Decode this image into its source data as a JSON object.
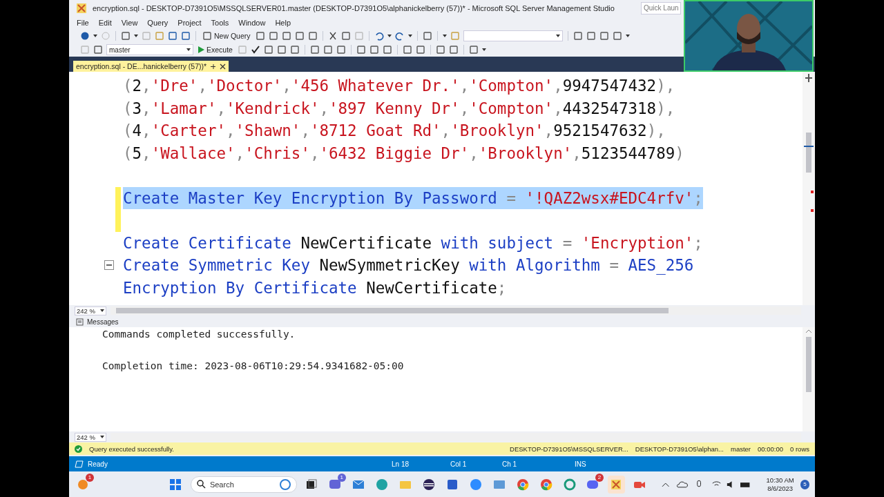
{
  "window": {
    "title": "encryption.sql - DESKTOP-D7391O5\\MSSQLSERVER01.master (DESKTOP-D7391O5\\alphanickelberry (57))* - Microsoft SQL Server Management Studio",
    "quick_launch": {
      "placeholder": "Quick Laun"
    }
  },
  "menu": [
    "File",
    "Edit",
    "View",
    "Query",
    "Project",
    "Tools",
    "Window",
    "Help"
  ],
  "toolbar": {
    "new_query": "New Query",
    "database": "master",
    "execute": "Execute"
  },
  "tabs": [
    {
      "label": "encryption.sql - DE...hanickelberry (57))*",
      "selected": true
    }
  ],
  "editor": {
    "zoom": "242 %",
    "lines": [
      {
        "kind": "code",
        "changed": false,
        "selected": false,
        "collapsible": false,
        "tokens": [
          {
            "kind": "punct",
            "text": "("
          },
          {
            "kind": "plain",
            "text": "2"
          },
          {
            "kind": "punct",
            "text": ","
          },
          {
            "kind": "string",
            "text": "'Dre'"
          },
          {
            "kind": "punct",
            "text": ","
          },
          {
            "kind": "string",
            "text": "'Doctor'"
          },
          {
            "kind": "punct",
            "text": ","
          },
          {
            "kind": "string",
            "text": "'456 Whatever Dr.'"
          },
          {
            "kind": "punct",
            "text": ","
          },
          {
            "kind": "string",
            "text": "'Compton'"
          },
          {
            "kind": "punct",
            "text": ","
          },
          {
            "kind": "plain",
            "text": "9947547432"
          },
          {
            "kind": "punct",
            "text": "),"
          }
        ]
      },
      {
        "kind": "code",
        "changed": false,
        "selected": false,
        "collapsible": false,
        "tokens": [
          {
            "kind": "punct",
            "text": "("
          },
          {
            "kind": "plain",
            "text": "3"
          },
          {
            "kind": "punct",
            "text": ","
          },
          {
            "kind": "string",
            "text": "'Lamar'"
          },
          {
            "kind": "punct",
            "text": ","
          },
          {
            "kind": "string",
            "text": "'Kendrick'"
          },
          {
            "kind": "punct",
            "text": ","
          },
          {
            "kind": "string",
            "text": "'897 Kenny Dr'"
          },
          {
            "kind": "punct",
            "text": ","
          },
          {
            "kind": "string",
            "text": "'Compton'"
          },
          {
            "kind": "punct",
            "text": ","
          },
          {
            "kind": "plain",
            "text": "4432547318"
          },
          {
            "kind": "punct",
            "text": "),"
          }
        ]
      },
      {
        "kind": "code",
        "changed": false,
        "selected": false,
        "collapsible": false,
        "tokens": [
          {
            "kind": "punct",
            "text": "("
          },
          {
            "kind": "plain",
            "text": "4"
          },
          {
            "kind": "punct",
            "text": ","
          },
          {
            "kind": "string",
            "text": "'Carter'"
          },
          {
            "kind": "punct",
            "text": ","
          },
          {
            "kind": "string",
            "text": "'Shawn'"
          },
          {
            "kind": "punct",
            "text": ","
          },
          {
            "kind": "string",
            "text": "'8712 Goat Rd'"
          },
          {
            "kind": "punct",
            "text": ","
          },
          {
            "kind": "string",
            "text": "'Brooklyn'"
          },
          {
            "kind": "punct",
            "text": ","
          },
          {
            "kind": "plain",
            "text": "9521547632"
          },
          {
            "kind": "punct",
            "text": "),"
          }
        ]
      },
      {
        "kind": "code",
        "changed": false,
        "selected": false,
        "collapsible": false,
        "tokens": [
          {
            "kind": "punct",
            "text": "("
          },
          {
            "kind": "plain",
            "text": "5"
          },
          {
            "kind": "punct",
            "text": ","
          },
          {
            "kind": "string",
            "text": "'Wallace'"
          },
          {
            "kind": "punct",
            "text": ","
          },
          {
            "kind": "string",
            "text": "'Chris'"
          },
          {
            "kind": "punct",
            "text": ","
          },
          {
            "kind": "string",
            "text": "'6432 Biggie Dr'"
          },
          {
            "kind": "punct",
            "text": ","
          },
          {
            "kind": "string",
            "text": "'Brooklyn'"
          },
          {
            "kind": "punct",
            "text": ","
          },
          {
            "kind": "plain",
            "text": "5123544789"
          },
          {
            "kind": "punct",
            "text": ")"
          }
        ]
      },
      {
        "kind": "blank",
        "changed": false,
        "selected": false,
        "collapsible": false
      },
      {
        "kind": "code",
        "changed": true,
        "selected": true,
        "collapsible": false,
        "tokens": [
          {
            "kind": "keyword",
            "text": "Create Master Key Encryption By Password"
          },
          {
            "kind": "punct",
            "text": " = "
          },
          {
            "kind": "string",
            "text": "'!QAZ2wsx#EDC4rfv'"
          },
          {
            "kind": "punct",
            "text": ";"
          }
        ]
      },
      {
        "kind": "blank",
        "changed": true,
        "selected": false,
        "collapsible": false
      },
      {
        "kind": "code",
        "changed": false,
        "selected": false,
        "collapsible": false,
        "tokens": [
          {
            "kind": "keyword",
            "text": "Create Certificate"
          },
          {
            "kind": "plain",
            "text": " NewCertificate "
          },
          {
            "kind": "keyword",
            "text": "with subject"
          },
          {
            "kind": "punct",
            "text": " = "
          },
          {
            "kind": "string",
            "text": "'Encryption'"
          },
          {
            "kind": "punct",
            "text": ";"
          }
        ]
      },
      {
        "kind": "code",
        "changed": false,
        "selected": false,
        "collapsible": true,
        "tokens": [
          {
            "kind": "keyword",
            "text": "Create Symmetric Key"
          },
          {
            "kind": "plain",
            "text": " NewSymmetricKey "
          },
          {
            "kind": "keyword",
            "text": "with Algorithm"
          },
          {
            "kind": "punct",
            "text": " = "
          },
          {
            "kind": "keyword",
            "text": "AES_256"
          }
        ]
      },
      {
        "kind": "code",
        "changed": false,
        "selected": false,
        "collapsible": false,
        "tokens": [
          {
            "kind": "keyword",
            "text": "Encryption By Certificate"
          },
          {
            "kind": "plain",
            "text": " NewCertificate"
          },
          {
            "kind": "punct",
            "text": ";"
          }
        ]
      }
    ]
  },
  "results": {
    "tab": "Messages",
    "zoom": "242 %",
    "lines": [
      "Commands completed successfully.",
      "Completion time: 2023-08-06T10:29:54.9341682-05:00"
    ]
  },
  "query_status": {
    "message": "Query executed successfully.",
    "server": "DESKTOP-D7391O5\\MSSQLSERVER...",
    "user": "DESKTOP-D7391O5\\alphan...",
    "database": "master",
    "elapsed": "00:00:00",
    "rows": "0 rows"
  },
  "status_bar": {
    "state": "Ready",
    "line": "Ln 18",
    "column": "Col 1",
    "char": "Ch 1",
    "mode": "INS"
  },
  "taskbar": {
    "search": {
      "placeholder": "Search"
    },
    "apps": [
      {
        "kind": "notify",
        "badge": "1"
      },
      {
        "kind": "start"
      },
      {
        "kind": "search"
      },
      {
        "kind": "taskview"
      },
      {
        "kind": "chat",
        "badge": "1"
      },
      {
        "kind": "mail"
      },
      {
        "kind": "edge"
      },
      {
        "kind": "folder"
      },
      {
        "kind": "eclipse"
      },
      {
        "kind": "store"
      },
      {
        "kind": "zoom"
      },
      {
        "kind": "remote"
      },
      {
        "kind": "chrome"
      },
      {
        "kind": "chrome"
      },
      {
        "kind": "circle"
      },
      {
        "kind": "discord",
        "badge": "2"
      },
      {
        "kind": "ssms",
        "selected": true
      },
      {
        "kind": "camera"
      }
    ],
    "time": "10:30 AM",
    "date": "8/6/2023",
    "notifications": "5"
  }
}
